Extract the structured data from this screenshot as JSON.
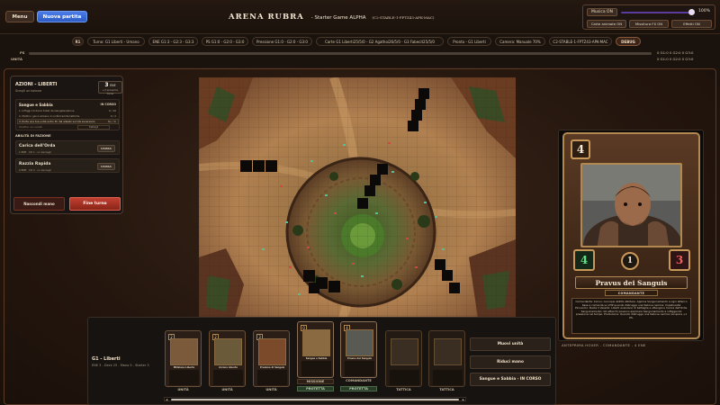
{
  "header": {
    "menu_label": "Menu",
    "new_game_label": "Nuova partita",
    "title": "ARENA RUBRA",
    "subtitle": "- Starter Game ALPHA",
    "build": "(C2-STABLE-1-FPTZ43-APK-MAC)"
  },
  "audio": {
    "music_label": "Musica ON",
    "volume_pct": "100%",
    "cards_anim_label": "Carte animate ON",
    "fx_mix_label": "Missitura FX ON",
    "effects_label": "Effetti ON"
  },
  "status": {
    "round": "R1",
    "turn": "Turno: G1 Liberti - Umano",
    "ene": "ENE G1:3 - G2:3 - G3:3",
    "ps": "PS G1:0 - G2:0 - G3:0",
    "pressure": "Pressione G1:0 - G2:0 - G3:0",
    "cards": "Carte G1 Liberti25/5/0 - G2 Agathoi26/5/0 - G3 Fabecit25/5/0",
    "ready": "Pronto - G1 Liberti",
    "camera": "Camera: Manuale 70%",
    "build": "C2-STABLE-1-FPTZ43-APK-MAC",
    "debug": "DEBUG"
  },
  "ps_row": {
    "ps_label": "PS",
    "units_label": "UNITÀ",
    "ps_vals": "0 G1:0 0 G2:0 0 G3:0",
    "units_vals": "0 G1:0 0 G2:0 0 G3:0"
  },
  "actions": {
    "title": "AZIONI - LIBERTI",
    "subtitle": "Scegli un'azione",
    "ene_value": "3",
    "ene_unit": "ENE",
    "ene_next": "+3 prossimo turno",
    "mission_name": "Sangue e Sabbia",
    "mission_status": "IN CORSO",
    "objectives": [
      {
        "text": "1. Infliggi 10 danni totali da Gangsterazione",
        "progress": "0 / 10"
      },
      {
        "text": "2. Metti in gioco almeno 2 unità tramite tattiche",
        "progress": "0 / 2"
      },
      {
        "text": "3. Porta una tua unità entro 3h dal alleato sul QG avversario",
        "progress": "No / Sì"
      }
    ],
    "objectives_footer": "Obiettivi non svelati",
    "objectives_button": "Dettagli",
    "abilities_title": "ABILITÀ DI FAZIONE",
    "abilities": [
      {
        "name": "Carica dell'Orda",
        "desc": "1 ENE · CD 1 · no bersagli",
        "use": "USURA"
      },
      {
        "name": "Razzia Rapida",
        "desc": "0 ENE · CD 2 · no bersagli",
        "use": "USURA"
      }
    ],
    "hide_hand_label": "Nascondi mano",
    "end_turn_label": "Fine turno"
  },
  "preview": {
    "cost": "4",
    "attack": "4",
    "range": "1",
    "health": "3",
    "name": "Pravus dei Sanguis",
    "type": "COMANDANTE",
    "text": "Comandante: bonus: ovunque abilità abilitare. Applica Sanguinamento a ogni attacco base e comanda su 2HP quando distrugge una fazione nemica. Impetuosità Pinnacolo: Ruota il Vessillo: Liberti avanzano di battaglia e ottengono Carica dell'Orda. Sanguinamento: Gli attacchi possono applicare Sanguinamento a infliggendo pressione nel tempo. Produzione: Quando distrugge una fazione nemica recupera +1 PS.",
    "caption": "ANTEPRIMA HOVER - COMANDANTE - 4 ENE"
  },
  "hand": {
    "player": "G1 - Liberti",
    "info": "ENE 3 - Deck 25 - Mano 5 - Starter 3",
    "cards": [
      {
        "cost": "2",
        "name": "Miliziano Liberto",
        "label": "UNITÀ",
        "kind": "unit"
      },
      {
        "cost": "2",
        "name": "Arciere Liberto",
        "label": "UNITÀ",
        "kind": "unit"
      },
      {
        "cost": "3",
        "name": "Predone di Sanguis",
        "label": "UNITÀ",
        "kind": "unit"
      },
      {
        "cost": "0",
        "name": "Sangue e Sabbia",
        "label": "MISSIONE",
        "kind": "mission",
        "extra": "PROTETTA"
      },
      {
        "cost": "4",
        "name": "Pravus dei Sanguis",
        "label": "COMANDANTE",
        "kind": "commander",
        "extra": "PROTETTA"
      },
      {
        "cost": "",
        "name": "",
        "label": "TATTICA",
        "kind": "tactic"
      },
      {
        "cost": "",
        "name": "",
        "label": "TATTICA",
        "kind": "tactic"
      }
    ],
    "move_units_label": "Muovi unità",
    "reduce_hand_label": "Riduci mano",
    "mission_status_label": "Sangue e Sabbia - IN CORSO"
  }
}
